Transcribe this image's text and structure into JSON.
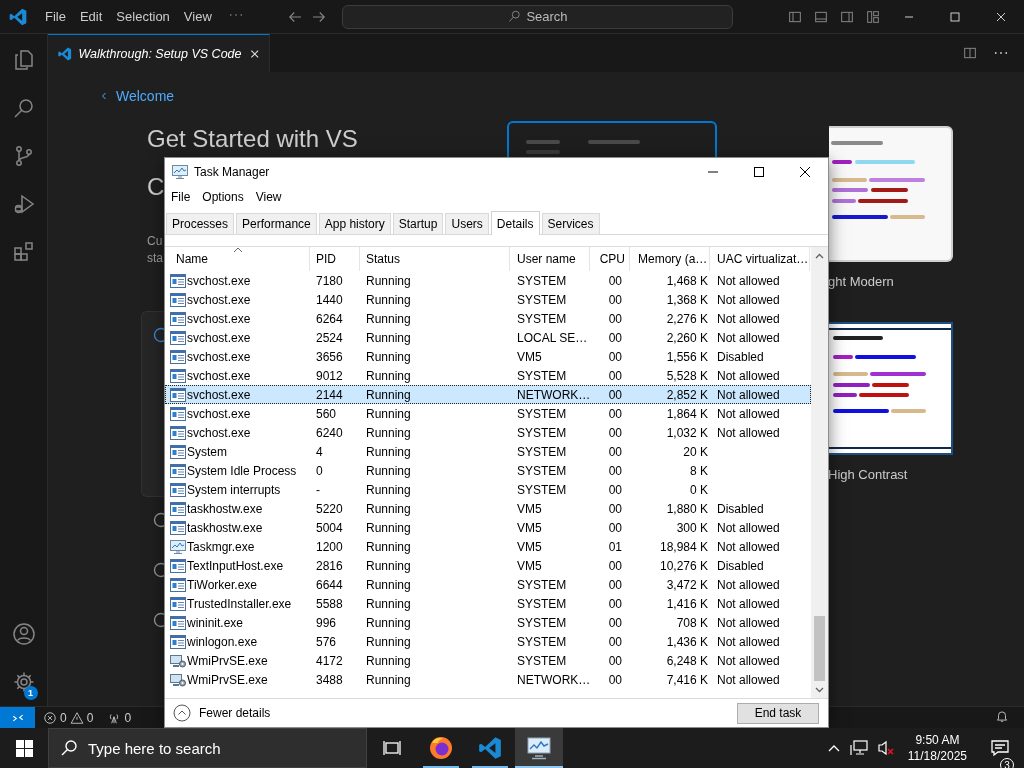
{
  "editor": {
    "menu": [
      "File",
      "Edit",
      "Selection",
      "View"
    ],
    "command_center": {
      "label": "Search"
    },
    "tab": {
      "title": "Walkthrough: Setup VS Code",
      "selected": true
    },
    "back_link": "Welcome",
    "heading": [
      "Get Started with VS",
      "C"
    ],
    "description": [
      "Cu",
      "sta"
    ],
    "themes": [
      {
        "kind": "dark",
        "selected": true
      },
      {
        "kind": "light",
        "label": "ght Modern",
        "selected": false
      },
      {
        "kind": "hc-light",
        "label": "High Contrast",
        "selected": false
      }
    ],
    "steps": [
      {
        "expanded": true
      },
      {
        "expanded": false
      },
      {
        "expanded": false
      },
      {
        "expanded": false
      }
    ],
    "settings_badge": "1",
    "status_bar": {
      "errors": "0",
      "warnings": "0",
      "ports": "0"
    }
  },
  "task_manager": {
    "title": "Task Manager",
    "menu": [
      "File",
      "Options",
      "View"
    ],
    "tabs": [
      {
        "label": "Processes",
        "selected": false
      },
      {
        "label": "Performance",
        "selected": false
      },
      {
        "label": "App history",
        "selected": false
      },
      {
        "label": "Startup",
        "selected": false
      },
      {
        "label": "Users",
        "selected": false
      },
      {
        "label": "Details",
        "selected": true
      },
      {
        "label": "Services",
        "selected": false
      }
    ],
    "columns": [
      "Name",
      "PID",
      "Status",
      "User name",
      "CPU",
      "Memory (a…",
      "UAC virtualizat…"
    ],
    "rows": [
      {
        "kind": "service",
        "name": "svchost.exe",
        "pid": "7180",
        "status": "Running",
        "user": "SYSTEM",
        "cpu": "00",
        "memory": "1,468 K",
        "uac": "Not allowed",
        "selected": false
      },
      {
        "kind": "service",
        "name": "svchost.exe",
        "pid": "1440",
        "status": "Running",
        "user": "SYSTEM",
        "cpu": "00",
        "memory": "1,368 K",
        "uac": "Not allowed",
        "selected": false
      },
      {
        "kind": "service",
        "name": "svchost.exe",
        "pid": "6264",
        "status": "Running",
        "user": "SYSTEM",
        "cpu": "00",
        "memory": "2,276 K",
        "uac": "Not allowed",
        "selected": false
      },
      {
        "kind": "service",
        "name": "svchost.exe",
        "pid": "2524",
        "status": "Running",
        "user": "LOCAL SE…",
        "cpu": "00",
        "memory": "2,260 K",
        "uac": "Not allowed",
        "selected": false
      },
      {
        "kind": "service",
        "name": "svchost.exe",
        "pid": "3656",
        "status": "Running",
        "user": "VM5",
        "cpu": "00",
        "memory": "1,556 K",
        "uac": "Disabled",
        "selected": false
      },
      {
        "kind": "service",
        "name": "svchost.exe",
        "pid": "9012",
        "status": "Running",
        "user": "SYSTEM",
        "cpu": "00",
        "memory": "5,528 K",
        "uac": "Not allowed",
        "selected": false
      },
      {
        "kind": "service",
        "name": "svchost.exe",
        "pid": "2144",
        "status": "Running",
        "user": "NETWORK…",
        "cpu": "00",
        "memory": "2,852 K",
        "uac": "Not allowed",
        "selected": true
      },
      {
        "kind": "service",
        "name": "svchost.exe",
        "pid": "560",
        "status": "Running",
        "user": "SYSTEM",
        "cpu": "00",
        "memory": "1,864 K",
        "uac": "Not allowed",
        "selected": false
      },
      {
        "kind": "service",
        "name": "svchost.exe",
        "pid": "6240",
        "status": "Running",
        "user": "SYSTEM",
        "cpu": "00",
        "memory": "1,032 K",
        "uac": "Not allowed",
        "selected": false
      },
      {
        "kind": "service",
        "name": "System",
        "pid": "4",
        "status": "Running",
        "user": "SYSTEM",
        "cpu": "00",
        "memory": "20 K",
        "selected": false
      },
      {
        "kind": "service",
        "name": "System Idle Process",
        "pid": "0",
        "status": "Running",
        "user": "SYSTEM",
        "cpu": "00",
        "memory": "8 K",
        "selected": false
      },
      {
        "kind": "service",
        "name": "System interrupts",
        "pid": "-",
        "status": "Running",
        "user": "SYSTEM",
        "cpu": "00",
        "memory": "0 K",
        "selected": false
      },
      {
        "kind": "service",
        "name": "taskhostw.exe",
        "pid": "5220",
        "status": "Running",
        "user": "VM5",
        "cpu": "00",
        "memory": "1,880 K",
        "uac": "Disabled",
        "selected": false
      },
      {
        "kind": "service",
        "name": "taskhostw.exe",
        "pid": "5004",
        "status": "Running",
        "user": "VM5",
        "cpu": "00",
        "memory": "300 K",
        "uac": "Not allowed",
        "selected": false
      },
      {
        "kind": "monitor",
        "name": "Taskmgr.exe",
        "pid": "1200",
        "status": "Running",
        "user": "VM5",
        "cpu": "01",
        "memory": "18,984 K",
        "uac": "Not allowed",
        "selected": false
      },
      {
        "kind": "service",
        "name": "TextInputHost.exe",
        "pid": "2816",
        "status": "Running",
        "user": "VM5",
        "cpu": "00",
        "memory": "10,276 K",
        "uac": "Disabled",
        "selected": false
      },
      {
        "kind": "service",
        "name": "TiWorker.exe",
        "pid": "6644",
        "status": "Running",
        "user": "SYSTEM",
        "cpu": "00",
        "memory": "3,472 K",
        "uac": "Not allowed",
        "selected": false
      },
      {
        "kind": "service",
        "name": "TrustedInstaller.exe",
        "pid": "5588",
        "status": "Running",
        "user": "SYSTEM",
        "cpu": "00",
        "memory": "1,416 K",
        "uac": "Not allowed",
        "selected": false
      },
      {
        "kind": "service",
        "name": "wininit.exe",
        "pid": "996",
        "status": "Running",
        "user": "SYSTEM",
        "cpu": "00",
        "memory": "708 K",
        "uac": "Not allowed",
        "selected": false
      },
      {
        "kind": "service",
        "name": "winlogon.exe",
        "pid": "576",
        "status": "Running",
        "user": "SYSTEM",
        "cpu": "00",
        "memory": "1,436 K",
        "uac": "Not allowed",
        "selected": false
      },
      {
        "kind": "computer",
        "name": "WmiPrvSE.exe",
        "pid": "4172",
        "status": "Running",
        "user": "SYSTEM",
        "cpu": "00",
        "memory": "6,248 K",
        "uac": "Not allowed",
        "selected": false
      },
      {
        "kind": "computer",
        "name": "WmiPrvSE.exe",
        "pid": "3488",
        "status": "Running",
        "user": "NETWORK…",
        "cpu": "00",
        "memory": "7,416 K",
        "uac": "Not allowed",
        "selected": false
      }
    ],
    "footer": {
      "toggle": "Fewer details",
      "button": "End task"
    }
  },
  "taskbar": {
    "search": {
      "placeholder": "Type here to search"
    },
    "apps": [
      {
        "kind": "task-view",
        "running": false,
        "selected": false
      },
      {
        "kind": "browser",
        "running": true,
        "selected": false
      },
      {
        "kind": "editor",
        "running": true,
        "selected": false
      },
      {
        "kind": "task-manager",
        "running": true,
        "selected": true
      }
    ],
    "time": "9:50 AM",
    "date": "11/18/2025",
    "notifications": "3"
  }
}
